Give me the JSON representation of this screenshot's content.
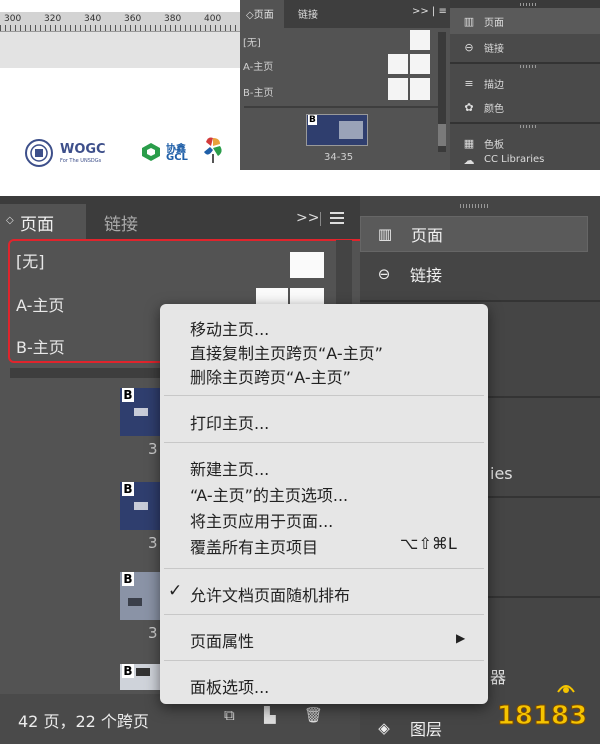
{
  "top": {
    "ruler_numbers": [
      "300",
      "320",
      "340",
      "360",
      "380",
      "400"
    ],
    "logos": {
      "wogc_text": "WOGC",
      "wogc_sub": "For The UNSDGs",
      "gcl_cn": "协鑫",
      "gcl_text": "GCL"
    },
    "panel": {
      "tab_pages": "◇页面",
      "tab_links": "链接",
      "ctrl": ">> | ≡",
      "master_none": "[无]",
      "master_a": "A-主页",
      "master_b": "B-主页",
      "spread_label": "34-35"
    },
    "side": {
      "items": [
        {
          "label": "页面",
          "icon": "pages-icon"
        },
        {
          "label": "链接",
          "icon": "links-icon"
        },
        {
          "label": "描边",
          "icon": "stroke-icon"
        },
        {
          "label": "颜色",
          "icon": "color-icon"
        },
        {
          "label": "色板",
          "icon": "swatches-icon"
        },
        {
          "label": "CC Libraries",
          "icon": "cc-libraries-icon"
        }
      ]
    }
  },
  "big": {
    "tabs": {
      "pages": "页面",
      "links": "链接",
      "arrow": "◇",
      "ctrl": ">>"
    },
    "masters": [
      "[无]",
      "A-主页",
      "B-主页"
    ],
    "spread_labels": [
      "3",
      "3",
      "3",
      "3"
    ],
    "status": "42 页，22 个跨页",
    "side": {
      "items": [
        {
          "label": "页面",
          "icon": "pages-icon"
        },
        {
          "label": "链接",
          "icon": "links-icon"
        },
        {
          "label": "图层",
          "icon": "layers-icon"
        }
      ],
      "fragments": [
        "ies",
        "器"
      ]
    }
  },
  "context_menu": {
    "items": [
      {
        "label": "移动主页..."
      },
      {
        "label": "直接复制主页跨页“A-主页”"
      },
      {
        "label": "删除主页跨页“A-主页”"
      },
      {
        "label": "打印主页..."
      },
      {
        "label": "新建主页..."
      },
      {
        "label": "“A-主页”的主页选项..."
      },
      {
        "label": "将主页应用于页面..."
      },
      {
        "label": "覆盖所有主页项目",
        "shortcut": "⌥⇧⌘L"
      },
      {
        "label": "允许文档页面随机排布",
        "checked": true
      },
      {
        "label": "页面属性",
        "submenu": true
      },
      {
        "label": "面板选项..."
      }
    ]
  },
  "watermark": {
    "text": "18183"
  },
  "colors": {
    "panel": "#535353",
    "highlight_box": "#e0242c",
    "menu_bg": "#e6e6e6",
    "watermark": "#f5c400"
  }
}
